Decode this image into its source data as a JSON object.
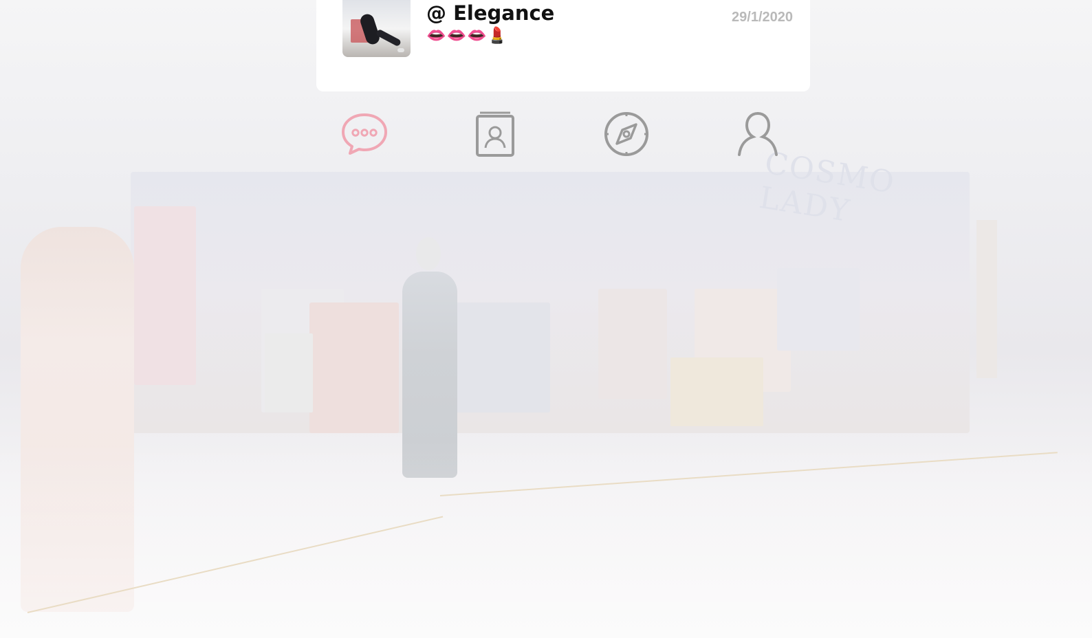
{
  "chat": {
    "name": "@ Elegance",
    "preview": "👄👄👄💄",
    "date": "29/1/2020"
  },
  "tabs": [
    {
      "icon": "chat-bubble-icon",
      "active": true
    },
    {
      "icon": "contacts-icon",
      "active": false
    },
    {
      "icon": "compass-icon",
      "active": false
    },
    {
      "icon": "person-icon",
      "active": false
    }
  ],
  "background": {
    "sign_text": "COSMO LADY"
  },
  "colors": {
    "active_tab": "#f0a7b4",
    "inactive_tab": "#9a9a9a",
    "card_bg": "#ffffff",
    "date_text": "#b9b9b9"
  }
}
